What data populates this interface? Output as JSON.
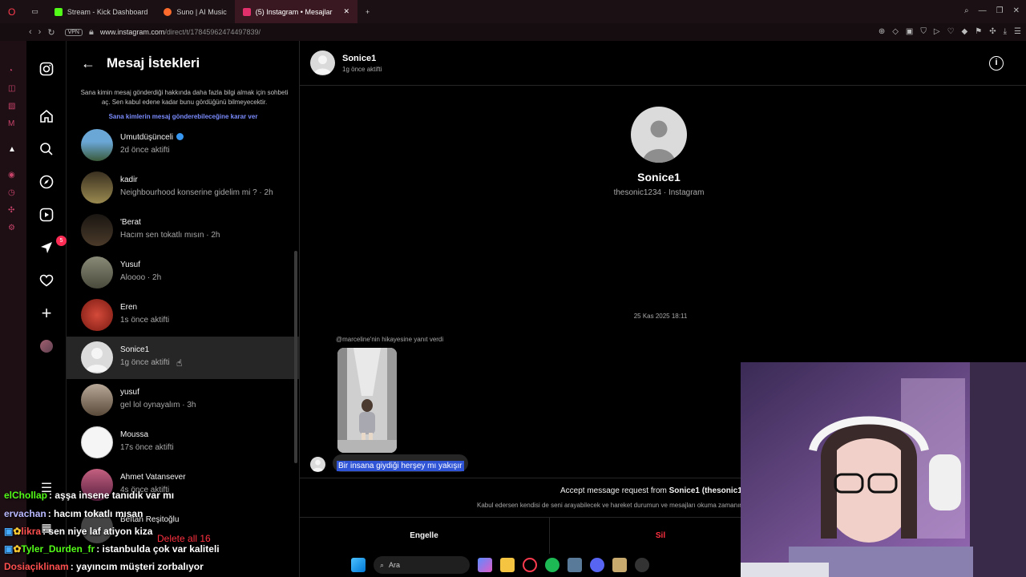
{
  "browser": {
    "tabs": [
      {
        "label": "Stream - Kick Dashboard",
        "color": "#53fc18"
      },
      {
        "label": "Suno | AI Music",
        "color": "#ff6b2c"
      },
      {
        "label": "(5) Instagram • Mesajlar",
        "color": "#e1306c"
      }
    ],
    "vpn": "VPN",
    "url_host": "www.instagram.com",
    "url_path": "/direct/t/17845962474497839/"
  },
  "ig_nav": {
    "notifications_badge": "5"
  },
  "requests": {
    "title": "Mesaj İstekleri",
    "info": "Sana kimin mesaj gönderdiği hakkında daha fazla bilgi almak için sohbeti aç. Sen kabul edene kadar bunu gördüğünü bilmeyecektir.",
    "link": "Sana kimlerin mesaj gönderebileceğine karar ver",
    "items": [
      {
        "name": "Umutdüşünceli",
        "sub": "2d önce aktifti",
        "verified": true,
        "color": "#4a88b8"
      },
      {
        "name": "kadir",
        "sub": "Neighbourhood konserine gidelim mi ? · 2h",
        "color": "#7a6a40"
      },
      {
        "name": "'Berat",
        "sub": "Hacım sen tokatlı mısın · 2h",
        "color": "#2b2520"
      },
      {
        "name": "Yusuf",
        "sub": "Aloooo · 2h",
        "color": "#6b6a5c"
      },
      {
        "name": "Eren",
        "sub": "1s önce aktifti",
        "color": "#b22b22"
      },
      {
        "name": "Sonice1",
        "sub": "1g önce aktifti",
        "color": "#d9d9d9"
      },
      {
        "name": "yusuf",
        "sub": "gel lol oynayalım · 3h",
        "color": "#8a7d70"
      },
      {
        "name": "Moussa",
        "sub": "17s önce aktifti",
        "color": "#f2f2f2"
      },
      {
        "name": "Ahmet Vatansever",
        "sub": "4s önce aktifti",
        "color": "#7a3050"
      },
      {
        "name": "Beftah Reşitoğlu",
        "sub": "",
        "color": "#444"
      }
    ]
  },
  "chat": {
    "name": "Sonice1",
    "status": "1g önce aktifti",
    "profile_name": "Sonice1",
    "profile_handle": "thesonic1234 · Instagram",
    "date": "25 Kas 2025 18:11",
    "replied": "@marceline'nin hikayesine yanıt verdi",
    "message": "Bir insana giydiği herşey mı yakışır",
    "accept_prefix": "Accept message request from ",
    "accept_name": "Sonice1 (thesonic1234)",
    "accept_info": "Kabul edersen kendisi de seni arayabilecek ve hareket durumun ve mesajları okuma zamanını görebilecek.",
    "block_label": "Engelle",
    "delete_label": "Sil"
  },
  "stream_chat": [
    {
      "user": "elChollap",
      "text": ": aşşa insene tanıdık var mı",
      "color": "#53fc18"
    },
    {
      "user": "ervachan",
      "text": ": hacım tokatlı mısan",
      "color": "#b8b8ff"
    },
    {
      "user": "likra",
      "text": ": sen niye laf atiyon kiza",
      "color": "#ff4f4f"
    },
    {
      "user": "Tyler_Durden_fr",
      "text": ": istanbulda çok var kaliteli",
      "color": "#53fc18"
    },
    {
      "user": "Dosiaçiklinam",
      "text": ": yayıncım müşteri zorbalıyor",
      "color": "#ff4f4f"
    }
  ],
  "delete_all": "Delete all 16",
  "taskbar": {
    "search": "Ara"
  }
}
